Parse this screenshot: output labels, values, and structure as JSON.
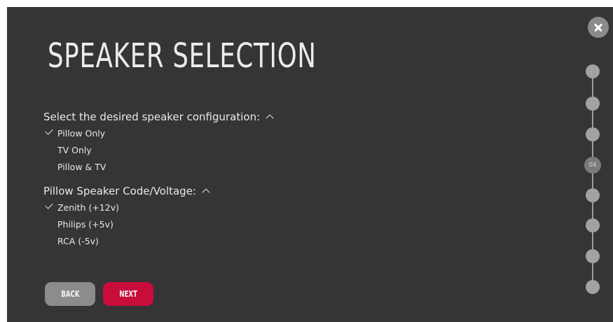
{
  "title": "SPEAKER SELECTION",
  "sections": [
    {
      "header": "Select the desired speaker configuration:",
      "options": [
        {
          "label": "Pillow Only",
          "selected": true
        },
        {
          "label": "TV Only",
          "selected": false
        },
        {
          "label": "Pillow & TV",
          "selected": false
        }
      ]
    },
    {
      "header": "Pillow Speaker Code/Voltage:",
      "options": [
        {
          "label": "Zenith (+12v)",
          "selected": true
        },
        {
          "label": "Philips (+5v)",
          "selected": false
        },
        {
          "label": "RCA (-5v)",
          "selected": false
        }
      ]
    }
  ],
  "buttons": {
    "back": "BACK",
    "next": "NEXT"
  },
  "progress": {
    "current_label": "04",
    "total_steps": 8,
    "current_step": 4
  },
  "colors": {
    "background": "#363435",
    "accent": "#c80d3a",
    "secondary_button": "#8c8c8c",
    "text": "#e9e9e9"
  },
  "icons": {
    "close": "close-icon",
    "check": "check-icon",
    "collapse": "chevron-up-icon"
  }
}
